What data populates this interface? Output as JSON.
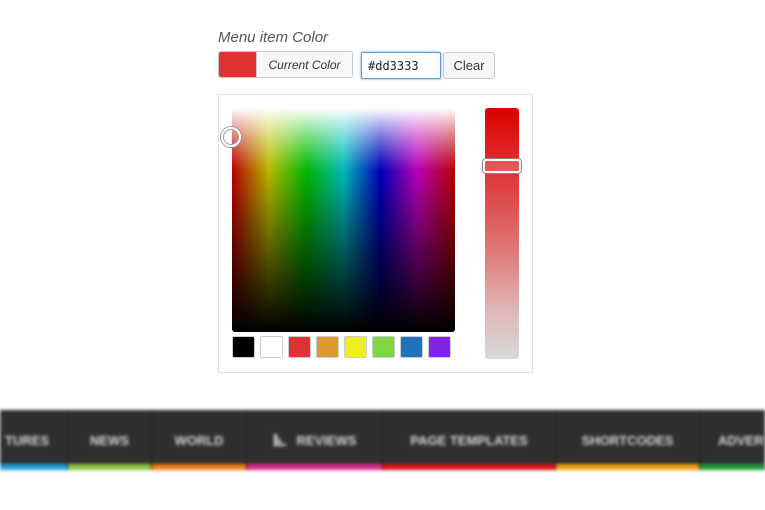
{
  "field": {
    "label": "Menu item Color",
    "current_color_label": "Current Color",
    "hex_value": "#dd3333",
    "clear_label": "Clear",
    "selected_color": "#dd3333"
  },
  "picker": {
    "palette": [
      "#000000",
      "#ffffff",
      "#dd3333",
      "#dd9933",
      "#eeee22",
      "#81d742",
      "#1e73be",
      "#8224e3"
    ]
  },
  "menu": {
    "items": [
      {
        "label": "TURES",
        "color": "#1e9fd8"
      },
      {
        "label": "NEWS",
        "color": "#8bc43f"
      },
      {
        "label": "WORLD",
        "color": "#f07b15"
      },
      {
        "label": "REVIEWS",
        "color": "#e0278f",
        "icon": "chart-icon"
      },
      {
        "label": "PAGE TEMPLATES",
        "color": "#d91414"
      },
      {
        "label": "SHORTCODES",
        "color": "#f2a00d"
      },
      {
        "label": "ADVER",
        "color": "#1f9c3b"
      }
    ]
  }
}
